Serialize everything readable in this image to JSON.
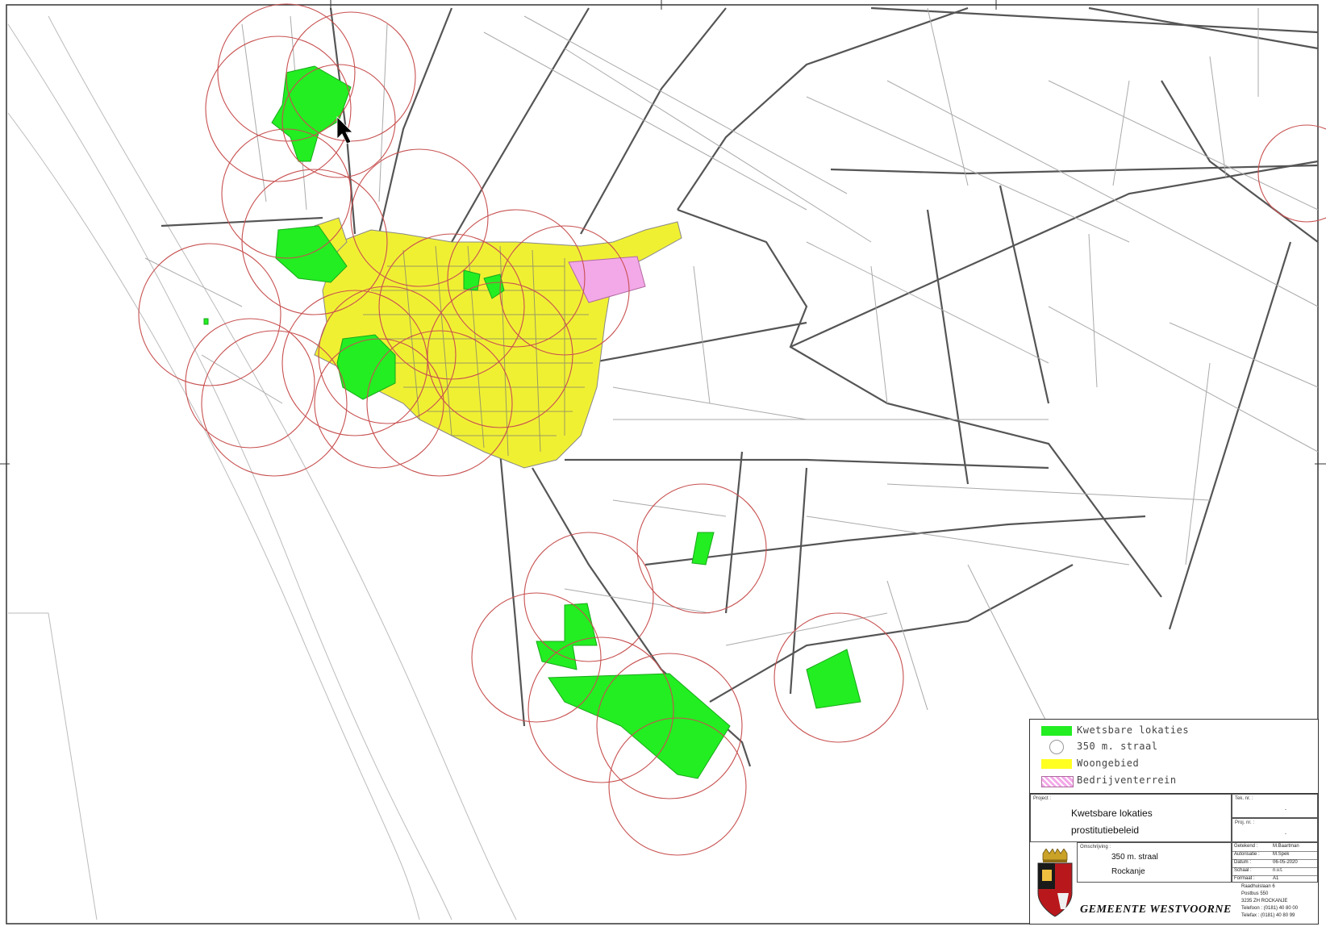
{
  "legend": {
    "items": [
      {
        "label": "Kwetsbare lokaties",
        "color": "#22ee22"
      },
      {
        "label": "350 m. straal",
        "color": "#ffffff"
      },
      {
        "label": "Woongebied",
        "color": "#ffff22"
      },
      {
        "label": "Bedrijventerrein",
        "color": "#f3a8e8"
      }
    ]
  },
  "titleblock": {
    "project_label": "Project :",
    "project_line1": "Kwetsbare lokaties",
    "project_line2": "prostitutiebeleid",
    "tek_label": "Tek. nr. :",
    "tek_value": "-",
    "proj_label": "Proj. nr. :",
    "proj_value": "-",
    "desc_label": "Omschrijving :",
    "desc_line1": "350 m. straal",
    "desc_line2": "Rockanje",
    "fields": [
      {
        "label": "Getekend :",
        "value": "M.Baartman"
      },
      {
        "label": "Autorisatie :",
        "value": "M.Spek"
      },
      {
        "label": "Datum :",
        "value": "06-05-2020"
      },
      {
        "label": "Schaal :",
        "value": "n.v.t."
      },
      {
        "label": "Formaat :",
        "value": "A1"
      }
    ],
    "org_name": "GEMEENTE WESTVOORNE",
    "address": [
      "Raadhuislaan 6",
      "Postbus 550",
      "3235 ZH ROCKANJE",
      "Telefoon : (0181) 40 80 00",
      "Telefax : (0181) 40 80 99"
    ]
  },
  "colors": {
    "road": "#555555",
    "parcel": "#999999",
    "circle": "#c85050",
    "vulnerable": "#22ee22",
    "residential": "#ffff22",
    "industrial": "#f3a8e8"
  }
}
